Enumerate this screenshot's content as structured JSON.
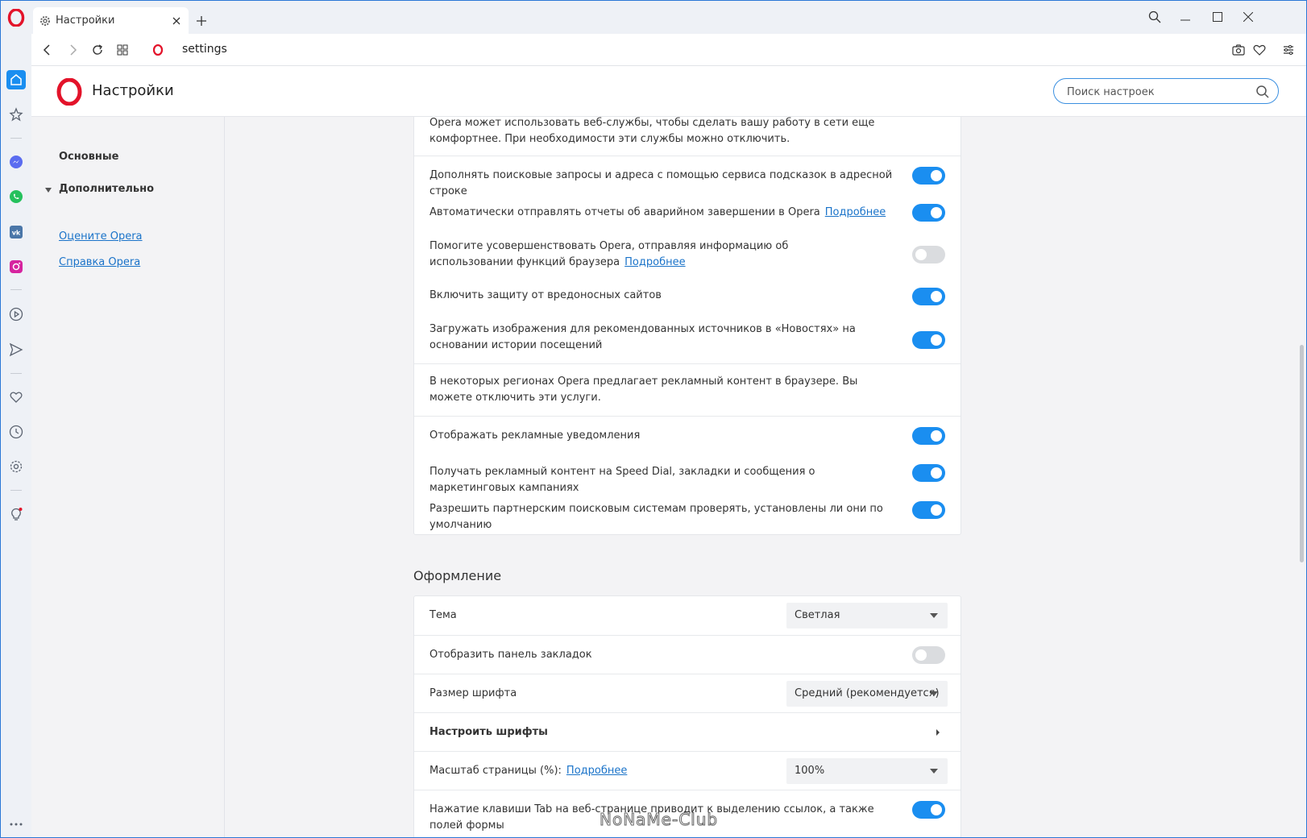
{
  "browser": {
    "tab_title": "Настройки",
    "url": "settings"
  },
  "header": {
    "title": "Настройки",
    "search_placeholder": "Поиск настроек"
  },
  "nav": {
    "basic": "Основные",
    "advanced": "Дополнительно",
    "rate_link": "Оцените Opera",
    "help_link": "Справка Opera"
  },
  "privacy": {
    "intro": "Opera может использовать веб-службы, чтобы сделать вашу работу в сети еще комфортнее. При необходимости эти службы можно отключить.",
    "rows": [
      {
        "label": "Дополнять поисковые запросы и адреса с помощью сервиса подсказок в адресной строке",
        "on": true
      },
      {
        "label": "Автоматически отправлять отчеты об аварийном завершении в Opera",
        "link": "Подробнее",
        "on": true
      },
      {
        "label": "Помогите усовершенствовать Opera, отправляя информацию об использовании функций браузера",
        "link": "Подробнее",
        "on": false
      },
      {
        "label": "Включить защиту от вредоносных сайтов",
        "on": true
      },
      {
        "label": "Загружать изображения для рекомендованных источников в «Новостях» на основании истории посещений",
        "on": true
      }
    ],
    "ads_intro": "В некоторых регионах Opera предлагает рекламный контент в браузере. Вы можете отключить эти услуги.",
    "ads_rows": [
      {
        "label": "Отображать рекламные уведомления",
        "on": true
      },
      {
        "label": "Получать рекламный контент на Speed Dial, закладки и сообщения о маркетинговых кампаниях",
        "on": true
      },
      {
        "label": "Разрешить партнерским поисковым системам проверять, установлены ли они по умолчанию",
        "on": true
      }
    ]
  },
  "appearance": {
    "title": "Оформление",
    "theme_label": "Тема",
    "theme_value": "Светлая",
    "bookmarks_bar_label": "Отобразить панель закладок",
    "bookmarks_bar_on": false,
    "font_size_label": "Размер шрифта",
    "font_size_value": "Средний (рекомендуется)",
    "fonts_label": "Настроить шрифты",
    "zoom_label": "Масштаб страницы (%):",
    "zoom_link": "Подробнее",
    "zoom_value": "100%",
    "tab_key_label": "Нажатие клавиши Tab на веб-странице приводит к выделению ссылок, а также полей формы",
    "tab_key_on": true
  },
  "watermark": "NoNaMe-Club",
  "colors": {
    "accent": "#1a8ef0",
    "opera_red": "#e3132a",
    "link": "#1a73c9"
  }
}
